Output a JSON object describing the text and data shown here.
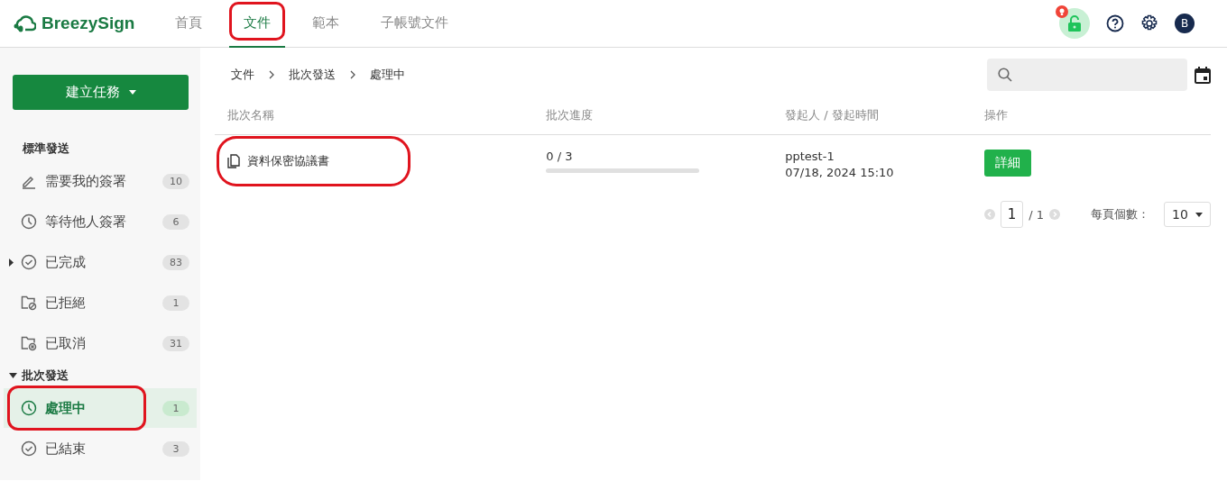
{
  "brand": "BreezySign",
  "nav": [
    {
      "label": "首頁",
      "selected": false,
      "highlighted": false
    },
    {
      "label": "文件",
      "selected": true,
      "highlighted": true
    },
    {
      "label": "範本",
      "selected": false,
      "highlighted": false
    },
    {
      "label": "子帳號文件",
      "selected": false,
      "highlighted": false
    }
  ],
  "user": {
    "initial": "B"
  },
  "create_button": "建立任務",
  "sections": [
    {
      "title": "標準發送",
      "items": [
        {
          "kind": "pen",
          "label": "需要我的簽署",
          "count": "10",
          "selected": false,
          "highlighted": false,
          "expandable": false
        },
        {
          "kind": "clock",
          "label": "等待他人簽署",
          "count": "6",
          "selected": false,
          "highlighted": false,
          "expandable": false
        },
        {
          "kind": "check",
          "label": "已完成",
          "count": "83",
          "selected": false,
          "highlighted": false,
          "expandable": true
        },
        {
          "kind": "folder-ban",
          "label": "已拒絕",
          "count": "1",
          "selected": false,
          "highlighted": false,
          "expandable": false
        },
        {
          "kind": "folder-x",
          "label": "已取消",
          "count": "31",
          "selected": false,
          "highlighted": false,
          "expandable": false
        }
      ]
    },
    {
      "title": "批次發送",
      "expanded": true,
      "items": [
        {
          "kind": "clock",
          "label": "處理中",
          "count": "1",
          "selected": true,
          "highlighted": true,
          "expandable": false
        },
        {
          "kind": "check",
          "label": "已結束",
          "count": "3",
          "selected": false,
          "highlighted": false,
          "expandable": false
        }
      ]
    }
  ],
  "breadcrumb": [
    "文件",
    "批次發送",
    "處理中"
  ],
  "table": {
    "columns": [
      "批次名稱",
      "批次進度",
      "發起人 / 發起時間",
      "操作"
    ],
    "rows": [
      {
        "name": "資料保密協議書",
        "highlighted": true,
        "progress": "0 / 3",
        "level": 0,
        "sender": "pptest-1",
        "time": "07/18, 2024 15:10",
        "action": "詳細"
      }
    ]
  },
  "pagination": {
    "page": "1",
    "total": "/ 1",
    "per_page_label": "每頁個數：",
    "per_page": "10"
  }
}
